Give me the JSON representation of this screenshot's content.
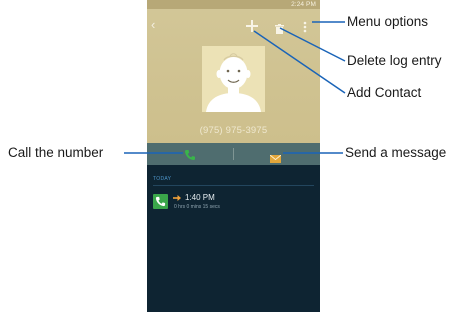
{
  "status_bar": {
    "time_text": "2:24 PM"
  },
  "toolbar": {
    "back_icon": "back-arrow-icon",
    "add_icon": "plus-icon",
    "delete_icon": "trash-icon",
    "menu_icon": "overflow-menu-icon"
  },
  "contact": {
    "phone_number": "(975) 975-3975"
  },
  "actions": {
    "call_icon": "phone-icon",
    "message_icon": "envelope-icon"
  },
  "log": {
    "section": "TODAY",
    "entries": [
      {
        "time": "1:40 PM",
        "duration": "0 hrs 0 mins 15 secs",
        "type": "outgoing"
      }
    ]
  },
  "callouts": {
    "menu": "Menu options",
    "delete": "Delete log entry",
    "add": "Add Contact",
    "call": "Call the number",
    "message": "Send a message"
  },
  "colors": {
    "contact_background": "#cdbf8c",
    "action_bar": "#4f6d6f",
    "log_background": "#0e2432",
    "call_green": "#3aa64a",
    "message_orange": "#e2a63a",
    "leader_blue": "#1a64b8"
  }
}
